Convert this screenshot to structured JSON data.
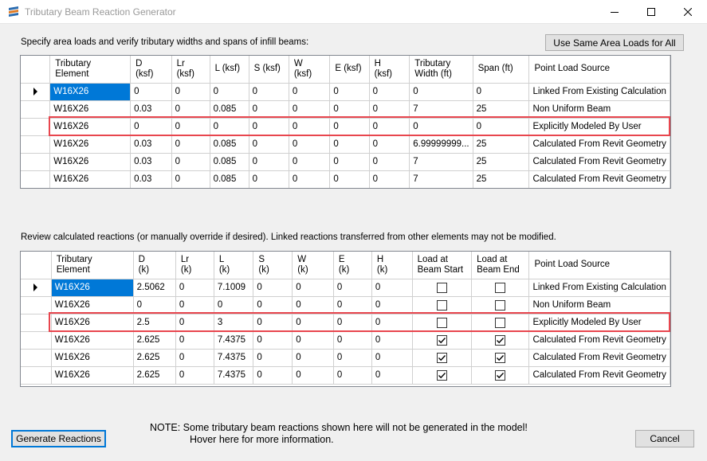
{
  "window": {
    "title": "Tributary Beam Reaction Generator"
  },
  "top": {
    "instructions": "Specify area loads and verify tributary widths and spans of infill beams:",
    "same_loads_button": "Use Same Area Loads for All",
    "headers": [
      "Tributary\nElement",
      "D\n(ksf)",
      "Lr\n(ksf)",
      "L (ksf)",
      "S (ksf)",
      "W\n(ksf)",
      "E (ksf)",
      "H\n(ksf)",
      "Tributary\nWidth (ft)",
      "Span (ft)",
      "Point Load Source"
    ],
    "rows": [
      {
        "cells": [
          "W16X26",
          "0",
          "0",
          "0",
          "0",
          "0",
          "0",
          "0",
          "0",
          "0",
          "Linked From Existing Calculation"
        ]
      },
      {
        "cells": [
          "W16X26",
          "0.03",
          "0",
          "0.085",
          "0",
          "0",
          "0",
          "0",
          "7",
          "25",
          "Non Uniform Beam"
        ]
      },
      {
        "cells": [
          "W16X26",
          "0",
          "0",
          "0",
          "0",
          "0",
          "0",
          "0",
          "0",
          "0",
          "Explicitly Modeled By User"
        ]
      },
      {
        "cells": [
          "W16X26",
          "0.03",
          "0",
          "0.085",
          "0",
          "0",
          "0",
          "0",
          "6.99999999...",
          "25",
          "Calculated From Revit Geometry"
        ]
      },
      {
        "cells": [
          "W16X26",
          "0.03",
          "0",
          "0.085",
          "0",
          "0",
          "0",
          "0",
          "7",
          "25",
          "Calculated From Revit Geometry"
        ]
      },
      {
        "cells": [
          "W16X26",
          "0.03",
          "0",
          "0.085",
          "0",
          "0",
          "0",
          "0",
          "7",
          "25",
          "Calculated From Revit Geometry"
        ]
      }
    ]
  },
  "bottom": {
    "instructions": "Review calculated reactions (or manually override if desired).  Linked reactions transferred from other elements may not be modified.",
    "headers": [
      "Tributary\nElement",
      "D\n(k)",
      "Lr\n(k)",
      "L\n(k)",
      "S\n(k)",
      "W\n(k)",
      "E\n(k)",
      "H\n(k)",
      "Load at\nBeam Start",
      "Load at\nBeam End",
      "Point Load Source"
    ],
    "rows": [
      {
        "cells": [
          "W16X26",
          "2.5062",
          "0",
          "7.1009",
          "0",
          "0",
          "0",
          "0"
        ],
        "start": false,
        "end": false,
        "source": "Linked From Existing Calculation"
      },
      {
        "cells": [
          "W16X26",
          "0",
          "0",
          "0",
          "0",
          "0",
          "0",
          "0"
        ],
        "start": false,
        "end": false,
        "source": "Non Uniform Beam"
      },
      {
        "cells": [
          "W16X26",
          "2.5",
          "0",
          "3",
          "0",
          "0",
          "0",
          "0"
        ],
        "start": false,
        "end": false,
        "source": "Explicitly Modeled By User"
      },
      {
        "cells": [
          "W16X26",
          "2.625",
          "0",
          "7.4375",
          "0",
          "0",
          "0",
          "0"
        ],
        "start": true,
        "end": true,
        "source": "Calculated From Revit Geometry"
      },
      {
        "cells": [
          "W16X26",
          "2.625",
          "0",
          "7.4375",
          "0",
          "0",
          "0",
          "0"
        ],
        "start": true,
        "end": true,
        "source": "Calculated From Revit Geometry"
      },
      {
        "cells": [
          "W16X26",
          "2.625",
          "0",
          "7.4375",
          "0",
          "0",
          "0",
          "0"
        ],
        "start": true,
        "end": true,
        "source": "Calculated From Revit Geometry"
      }
    ]
  },
  "note": {
    "line1": "NOTE:  Some tributary beam reactions shown here will not be generated in the model!",
    "line2": "Hover here for more information."
  },
  "buttons": {
    "generate": "Generate Reactions",
    "cancel": "Cancel"
  },
  "colors": {
    "selection": "#0078d7",
    "highlight": "#e8464e"
  }
}
